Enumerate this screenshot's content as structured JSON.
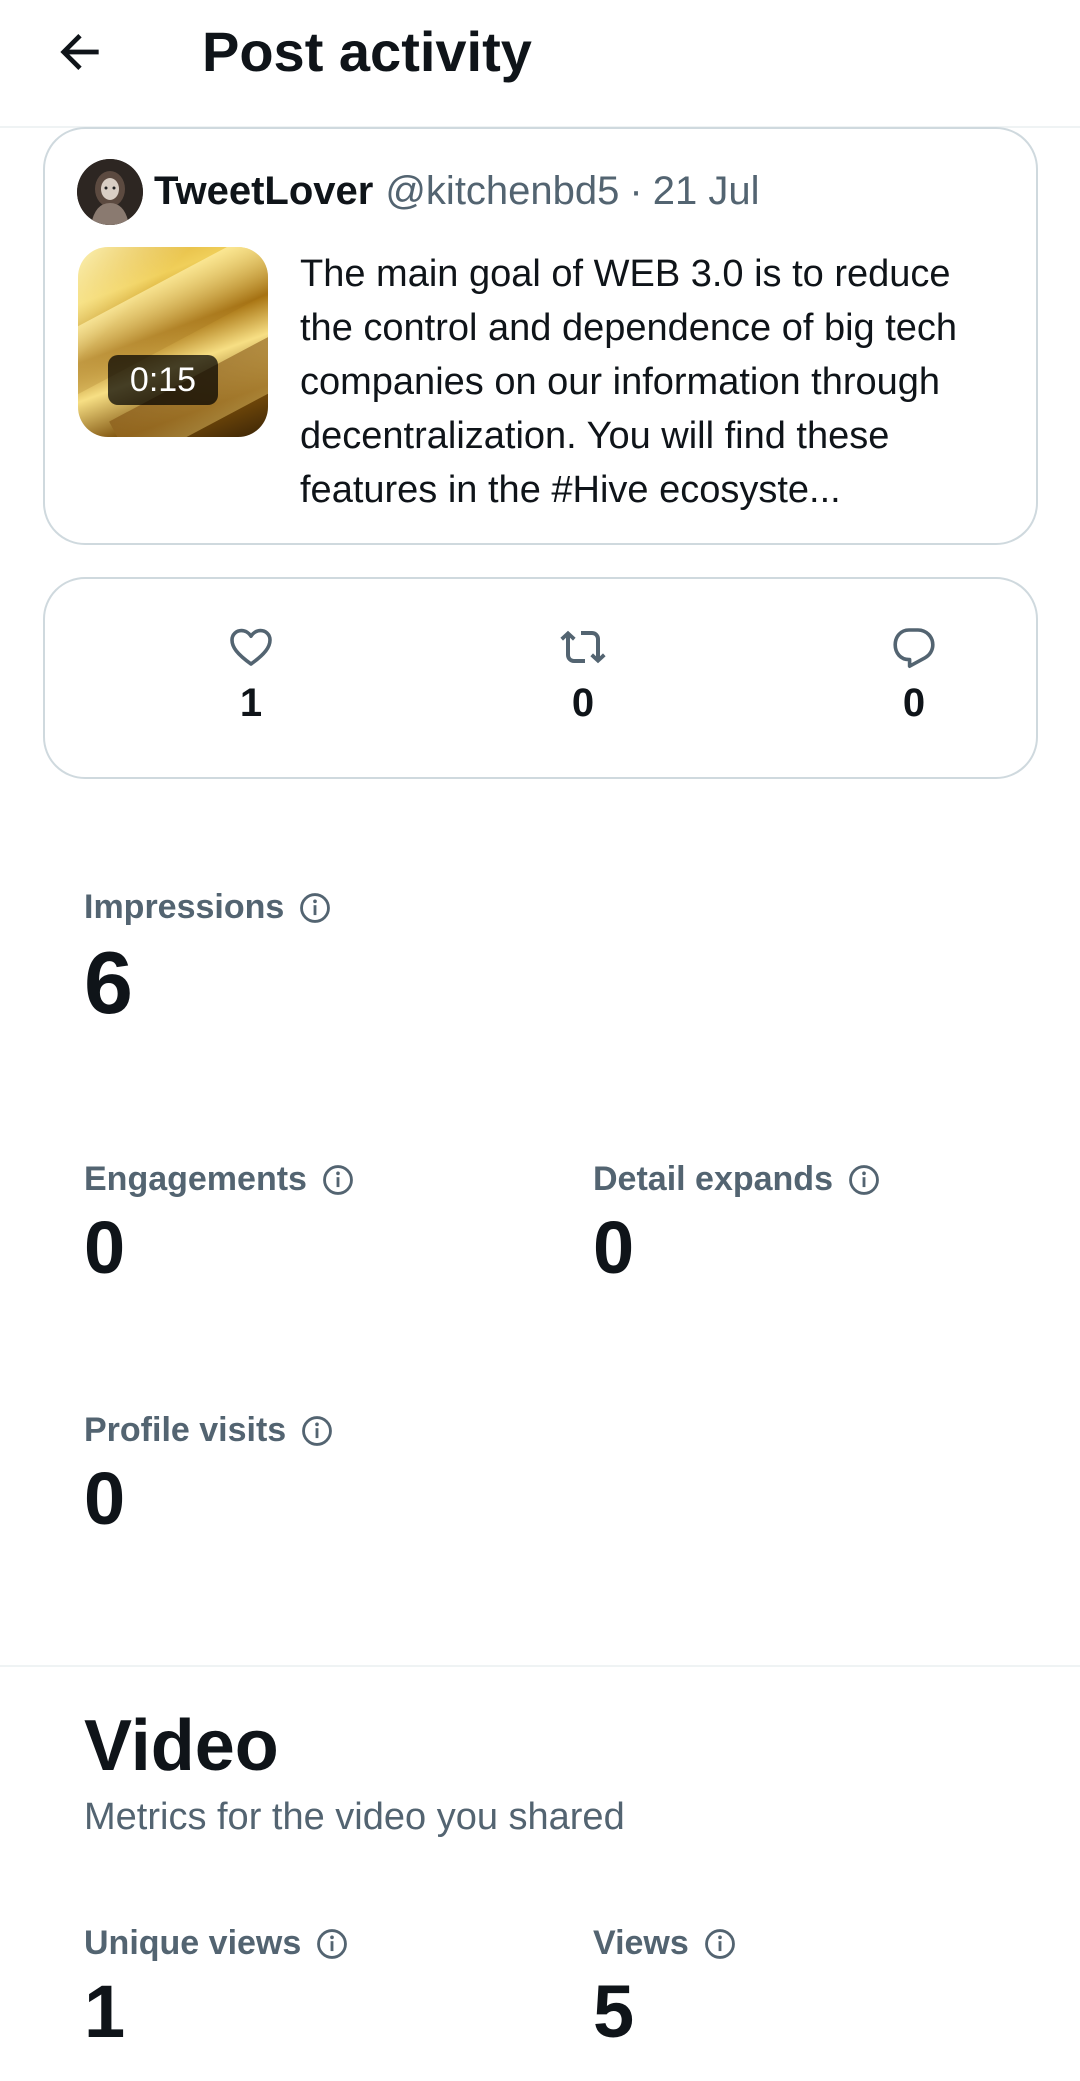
{
  "header": {
    "title": "Post activity",
    "back_icon": "arrow-left-icon"
  },
  "post": {
    "author_name": "TweetLover",
    "author_handle": "@kitchenbd5",
    "separator": "·",
    "date": "21 Jul",
    "video_duration": "0:15",
    "text": "The main goal of WEB 3.0 is to reduce the control and dependence of big tech companies on our information through decentralization. You will find these features in the #Hive ecosyste..."
  },
  "stats": {
    "likes": {
      "icon": "heart-icon",
      "count": "1"
    },
    "reposts": {
      "icon": "repost-icon",
      "count": "0"
    },
    "replies": {
      "icon": "reply-icon",
      "count": "0"
    }
  },
  "metrics": {
    "impressions": {
      "label": "Impressions",
      "value": "6"
    },
    "engagements": {
      "label": "Engagements",
      "value": "0"
    },
    "detail_expands": {
      "label": "Detail expands",
      "value": "0"
    },
    "profile_visits": {
      "label": "Profile visits",
      "value": "0"
    }
  },
  "video": {
    "title": "Video",
    "subtitle": "Metrics for the video you shared",
    "unique_views": {
      "label": "Unique views",
      "value": "1"
    },
    "views": {
      "label": "Views",
      "value": "5"
    }
  },
  "colors": {
    "text_primary": "#0f1419",
    "text_secondary": "#536471",
    "border": "#cfd9de"
  }
}
